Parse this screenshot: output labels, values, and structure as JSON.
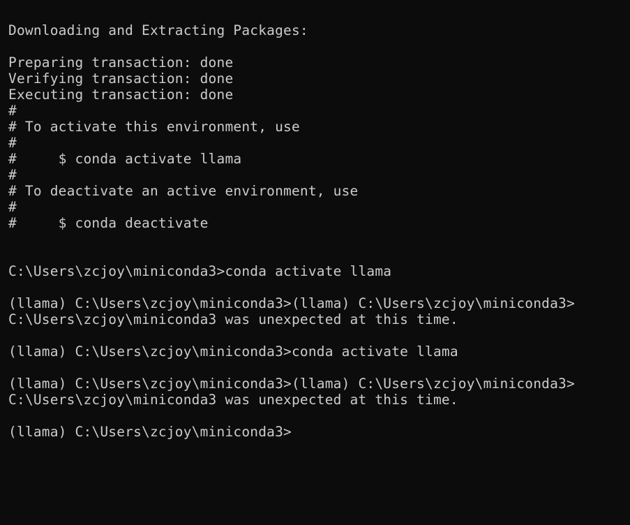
{
  "terminal": {
    "lines": [
      "Downloading and Extracting Packages:",
      "",
      "Preparing transaction: done",
      "Verifying transaction: done",
      "Executing transaction: done",
      "#",
      "# To activate this environment, use",
      "#",
      "#     $ conda activate llama",
      "#",
      "# To deactivate an active environment, use",
      "#",
      "#     $ conda deactivate",
      "",
      "",
      "C:\\Users\\zcjoy\\miniconda3>conda activate llama",
      "",
      "(llama) C:\\Users\\zcjoy\\miniconda3>(llama) C:\\Users\\zcjoy\\miniconda3>",
      "C:\\Users\\zcjoy\\miniconda3 was unexpected at this time.",
      "",
      "(llama) C:\\Users\\zcjoy\\miniconda3>conda activate llama",
      "",
      "(llama) C:\\Users\\zcjoy\\miniconda3>(llama) C:\\Users\\zcjoy\\miniconda3>",
      "C:\\Users\\zcjoy\\miniconda3 was unexpected at this time.",
      "",
      "(llama) C:\\Users\\zcjoy\\miniconda3>"
    ]
  },
  "colors": {
    "background": "#0c0c0c",
    "text": "#cccccc"
  }
}
